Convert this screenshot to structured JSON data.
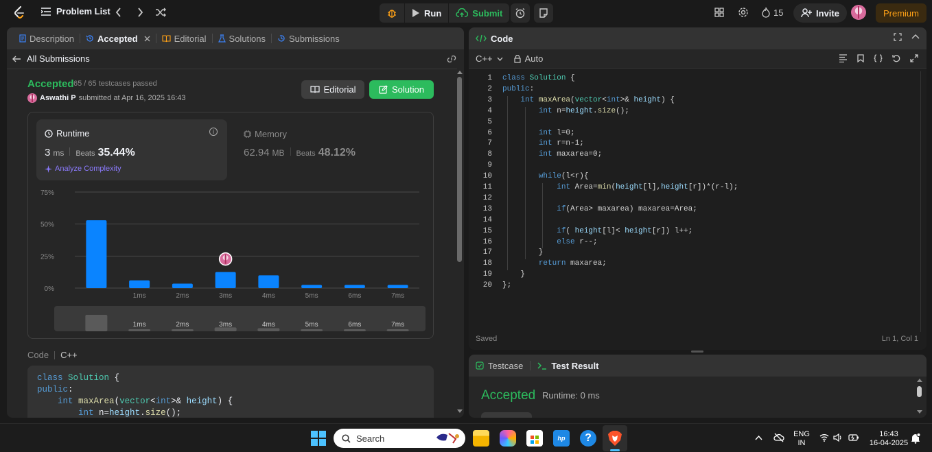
{
  "topnav": {
    "problem_list": "Problem List",
    "run": "Run",
    "submit": "Submit",
    "streak": "15",
    "invite": "Invite",
    "premium": "Premium"
  },
  "left_tabs": {
    "description": "Description",
    "accepted": "Accepted",
    "editorial": "Editorial",
    "solutions": "Solutions",
    "submissions": "Submissions"
  },
  "submission": {
    "back_label": "All Submissions",
    "status": "Accepted",
    "testcases": "65 / 65 testcases passed",
    "user": "Aswathi P",
    "submitted_text": "submitted at Apr 16, 2025 16:43",
    "editorial_btn": "Editorial",
    "solution_btn": "Solution"
  },
  "stats": {
    "runtime_label": "Runtime",
    "runtime_value": "3",
    "runtime_unit": "ms",
    "runtime_beats_label": "Beats",
    "runtime_beats": "35.44%",
    "analyze": "Analyze Complexity",
    "memory_label": "Memory",
    "memory_value": "62.94",
    "memory_unit": "MB",
    "memory_beats_label": "Beats",
    "memory_beats": "48.12%"
  },
  "chart_data": {
    "type": "bar",
    "categories": [
      "0ms",
      "1ms",
      "2ms",
      "3ms",
      "4ms",
      "5ms",
      "6ms",
      "7ms"
    ],
    "tick_labels": [
      "",
      "1ms",
      "2ms",
      "3ms",
      "4ms",
      "5ms",
      "6ms",
      "7ms"
    ],
    "values": [
      53,
      6,
      3.5,
      12.5,
      10,
      2.5,
      2.5,
      2.5
    ],
    "y_ticks": [
      "75%",
      "50%",
      "25%",
      "0%"
    ],
    "ylim": [
      0,
      75
    ],
    "highlight_category": "3ms",
    "grid": true,
    "bar_color": "#0a84ff"
  },
  "code_preview": {
    "label": "Code",
    "lang": "C++",
    "lines": [
      "class Solution {",
      "public:",
      "    int maxArea(vector<int>& height) {",
      "        int n=height.size();"
    ]
  },
  "code_panel": {
    "title": "Code",
    "language": "C++",
    "mode": "Auto",
    "saved": "Saved",
    "position": "Ln 1, Col 1",
    "lines": [
      "class Solution {",
      "public:",
      "    int maxArea(vector<int>& height) {",
      "        int n=height.size();",
      "",
      "        int l=0;",
      "        int r=n-1;",
      "        int maxarea=0;",
      "",
      "        while(l<r){",
      "            int Area=min(height[l],height[r])*(r-l);",
      "",
      "            if(Area> maxarea) maxarea=Area;",
      "",
      "            if( height[l]< height[r]) l++;",
      "            else r--;",
      "        }",
      "        return maxarea;",
      "    }",
      "};"
    ]
  },
  "result_panel": {
    "testcase_tab": "Testcase",
    "result_tab": "Test Result",
    "status": "Accepted",
    "runtime": "Runtime: 0 ms"
  },
  "taskbar": {
    "search": "Search",
    "lang_top": "ENG",
    "lang_bottom": "IN",
    "time": "16:43",
    "date": "16-04-2025"
  }
}
